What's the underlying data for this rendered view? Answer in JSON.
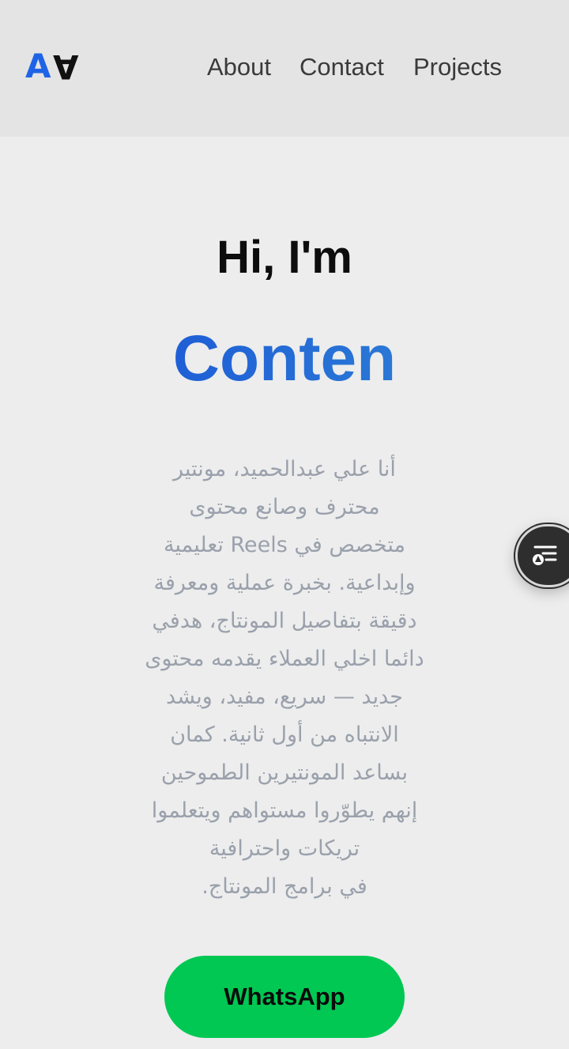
{
  "header": {
    "logo": {
      "left": "A",
      "right": "A"
    },
    "nav": [
      {
        "label": "About"
      },
      {
        "label": "Contact"
      },
      {
        "label": "Projects"
      }
    ]
  },
  "hero": {
    "greeting": "Hi, I'm",
    "role": "Conten",
    "bio_lines": [
      "أنا علي عبدالحميد، مونتير",
      "محترف وصانع محتوى",
      "متخصص في Reels تعليمية",
      "وإبداعية. بخبرة عملية ومعرفة",
      "دقيقة بتفاصيل المونتاج، هدفي",
      "دائما اخلي العملاء يقدمه محتوى",
      "جديد — سريع، مفيد، ويشد",
      "الانتباه من أول ثانية. كمان",
      "بساعد المونتيرين الطموحين",
      "إنهم يطوّروا مستواهم ويتعلموا",
      "تريكات واحترافية",
      "في برامج المونتاج."
    ],
    "cta_label": "WhatsApp"
  },
  "floating_button": {
    "icon": "reader-menu-icon"
  },
  "colors": {
    "header_bg": "#e4e4e4",
    "page_bg": "#ededed",
    "accent_blue": "#2364d2",
    "whatsapp_green": "#00c853",
    "bio_text": "#9aa1ac"
  }
}
